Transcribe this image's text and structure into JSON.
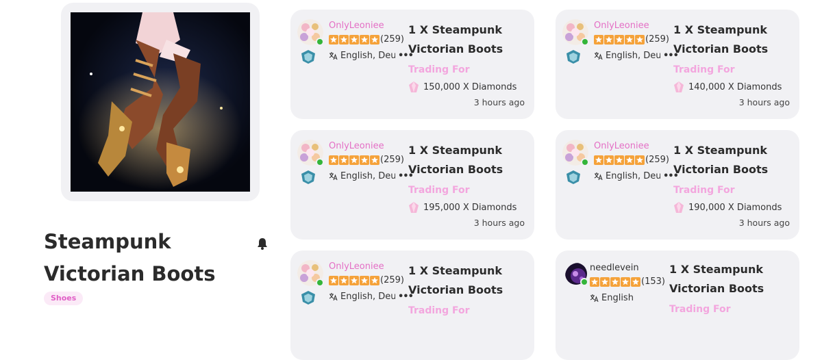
{
  "item": {
    "title": "Steampunk Victorian Boots",
    "category_tag": "Shoes"
  },
  "colors": {
    "username_pink": "#e46fc5",
    "trading_for_pink": "#f3a6de",
    "card_bg": "#f1f1f4",
    "star": "#f5a23a",
    "online": "#34b53a"
  },
  "listings": [
    {
      "username": "OnlyLeoniee",
      "username_color": "#e46fc5",
      "rating": "(259)",
      "languages": "English, Deu",
      "offer": "1 X Steampunk Victorian Boots",
      "trading_for_label": "Trading For",
      "price": "150,000 X Diamonds",
      "time": "3 hours ago",
      "avatar": "flower-avatar"
    },
    {
      "username": "OnlyLeoniee",
      "username_color": "#e46fc5",
      "rating": "(259)",
      "languages": "English, Deu",
      "offer": "1 X Steampunk Victorian Boots",
      "trading_for_label": "Trading For",
      "price": "140,000 X Diamonds",
      "time": "3 hours ago",
      "avatar": "flower-avatar"
    },
    {
      "username": "OnlyLeoniee",
      "username_color": "#e46fc5",
      "rating": "(259)",
      "languages": "English, Deu",
      "offer": "1 X Steampunk Victorian Boots",
      "trading_for_label": "Trading For",
      "price": "195,000 X Diamonds",
      "time": "3 hours ago",
      "avatar": "flower-avatar"
    },
    {
      "username": "OnlyLeoniee",
      "username_color": "#e46fc5",
      "rating": "(259)",
      "languages": "English, Deu",
      "offer": "1 X Steampunk Victorian Boots",
      "trading_for_label": "Trading For",
      "price": "190,000 X Diamonds",
      "time": "3 hours ago",
      "avatar": "flower-avatar"
    },
    {
      "username": "OnlyLeoniee",
      "username_color": "#e46fc5",
      "rating": "(259)",
      "languages": "English, Deu",
      "offer": "1 X Steampunk Victorian Boots",
      "trading_for_label": "Trading For",
      "price": "",
      "time": "",
      "avatar": "flower-avatar"
    },
    {
      "username": "needlevein",
      "username_color": "#333333",
      "rating": "(153)",
      "languages": "English",
      "offer": "1 X Steampunk Victorian Boots",
      "trading_for_label": "Trading For",
      "price": "",
      "time": "",
      "avatar": "purple-avatar"
    }
  ]
}
